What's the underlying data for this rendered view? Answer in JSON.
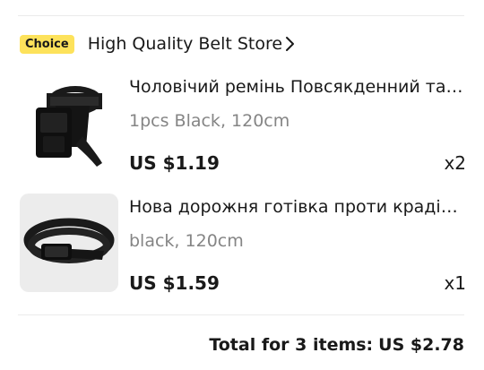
{
  "store": {
    "badge": "Choice",
    "name": "High Quality Belt Store"
  },
  "items": [
    {
      "title": "Чоловічий ремінь Повсякденний тактичний ремінь",
      "variant": "1pcs Black, 120cm",
      "price": "US $1.19",
      "qty": "x2",
      "image": "black-nylon-belt-icon"
    },
    {
      "title": "Нова дорожня готівка проти крадіжки ремінь",
      "variant": "black, 120cm",
      "price": "US $1.59",
      "qty": "x1",
      "image": "black-travel-belt-icon"
    }
  ],
  "summary": {
    "label": "Total for 3 items:",
    "value": "US $2.78"
  },
  "colors": {
    "badge_bg": "#fde25b",
    "text": "#191919",
    "muted": "#858585"
  }
}
